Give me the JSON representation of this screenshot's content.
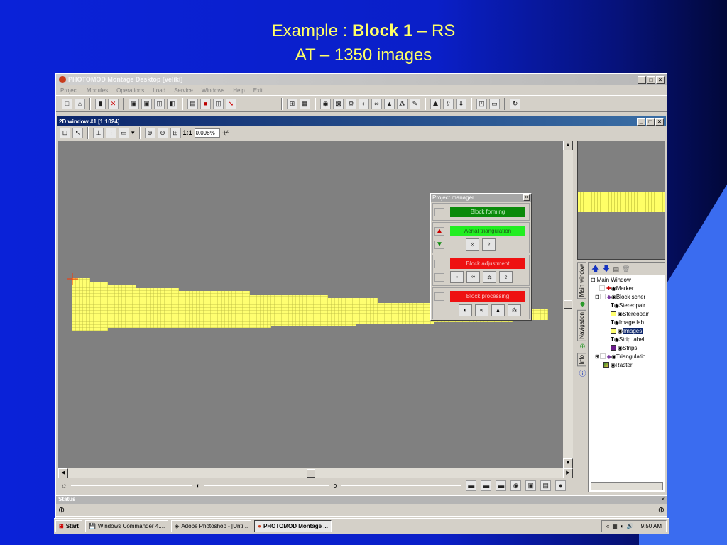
{
  "slide": {
    "title_prefix": "Example : ",
    "title_bold": "Block 1",
    "title_suffix": " – RS",
    "subtitle": "AT – 1350 images"
  },
  "app": {
    "title": "PHOTOMOD Montage Desktop [veliki]",
    "menu": [
      "Project",
      "Modules",
      "Operations",
      "Load",
      "Service",
      "Windows",
      "Help",
      "Exit"
    ]
  },
  "window2d": {
    "title": "2D window #1 [1:1024]",
    "zoom_label": "1:1",
    "zoom_value": "0.098%"
  },
  "project_manager": {
    "title": "Project manager",
    "block_forming": "Block forming",
    "aerial_triangulation": "Aerial triangulation",
    "block_adjustment": "Block adjustment",
    "block_processing": "Block processing",
    "colors": {
      "forming": "#0a8a0a",
      "triangulation": "#22ee22",
      "adjustment": "#ee1111",
      "processing": "#ee1111"
    }
  },
  "side_tabs": [
    "Main window",
    "Navigation",
    "Info"
  ],
  "tree": {
    "root": "Main Window",
    "items": [
      {
        "label": "Marker",
        "level": 1
      },
      {
        "label": "Block scher",
        "level": 1
      },
      {
        "label": "Stereopair",
        "level": 2
      },
      {
        "label": "Stereopair",
        "level": 2
      },
      {
        "label": "Image lab",
        "level": 2
      },
      {
        "label": "Images",
        "level": 2,
        "selected": true
      },
      {
        "label": "Strip label",
        "level": 2
      },
      {
        "label": "Strips",
        "level": 2
      },
      {
        "label": "Triangulatio",
        "level": 1
      },
      {
        "label": "Raster",
        "level": 1
      }
    ]
  },
  "status": {
    "title": "Status"
  },
  "taskbar": {
    "start": "Start",
    "tasks": [
      "Windows Commander 4....",
      "Adobe Photoshop - [Unti...",
      "PHOTOMOD Montage ..."
    ],
    "clock": "9:50 AM",
    "tray_prefix": "«"
  }
}
